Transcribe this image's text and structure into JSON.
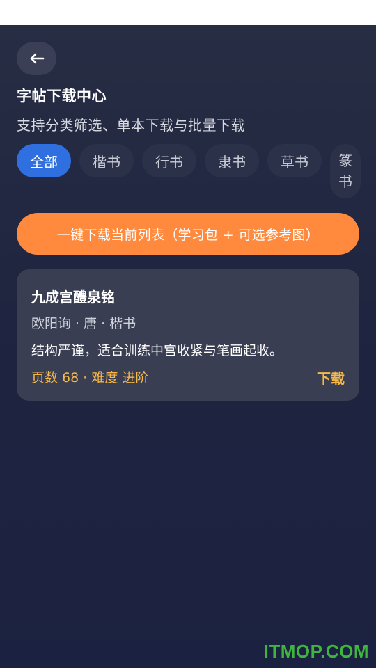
{
  "header": {
    "back_icon": "arrow-left-icon",
    "title": "字帖下载中心",
    "subtitle": "支持分类筛选、单本下载与批量下载"
  },
  "tabs": [
    {
      "label": "全部",
      "active": true
    },
    {
      "label": "楷书",
      "active": false
    },
    {
      "label": "行书",
      "active": false
    },
    {
      "label": "隶书",
      "active": false
    },
    {
      "label": "草书",
      "active": false
    },
    {
      "label": "篆书",
      "label_line1": "篆",
      "label_line2": "书",
      "active": false
    }
  ],
  "download_all_button": "一键下载当前列表（学习包 + 可选参考图）",
  "items": [
    {
      "title": "九成宫醴泉铭",
      "meta": "欧阳询 · 唐 · 楷书",
      "description": "结构严谨，适合训练中宫收紧与笔画起收。",
      "stats": "页数 68 · 难度 进阶",
      "download_label": "下载"
    }
  ],
  "watermark": "ITMOP.COM",
  "colors": {
    "accent_blue": "#2f6fe0",
    "accent_orange": "#ff8a3d",
    "accent_gold": "#f5b84a",
    "background": "#1f2540",
    "card": "#3a3e52"
  }
}
